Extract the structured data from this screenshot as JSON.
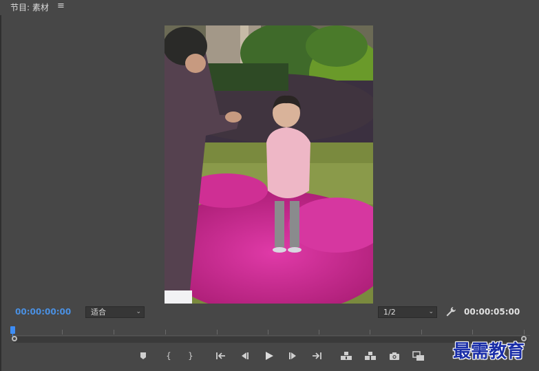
{
  "panel": {
    "title": "节目: 素材",
    "menu_icon": "hamburger-menu-icon"
  },
  "timecode": {
    "current": "00:00:00:00",
    "duration": "00:00:05:00"
  },
  "zoom_select": {
    "value": "适合"
  },
  "resolution_select": {
    "value": "1/2"
  },
  "playhead": {
    "position_fraction": 0
  },
  "transport_icons": [
    "add-marker-icon",
    "mark-in-icon",
    "mark-out-icon",
    "go-to-in-icon",
    "step-back-icon",
    "play-icon",
    "step-forward-icon",
    "go-to-out-icon",
    "lift-icon",
    "extract-icon",
    "export-frame-icon",
    "comparison-view-icon"
  ],
  "add_button": {
    "label": "+"
  },
  "watermark": {
    "text": "最需教育"
  },
  "colors": {
    "panel_bg": "#474747",
    "timecode_accent": "#4a90e2",
    "playhead": "#3d8df5"
  }
}
